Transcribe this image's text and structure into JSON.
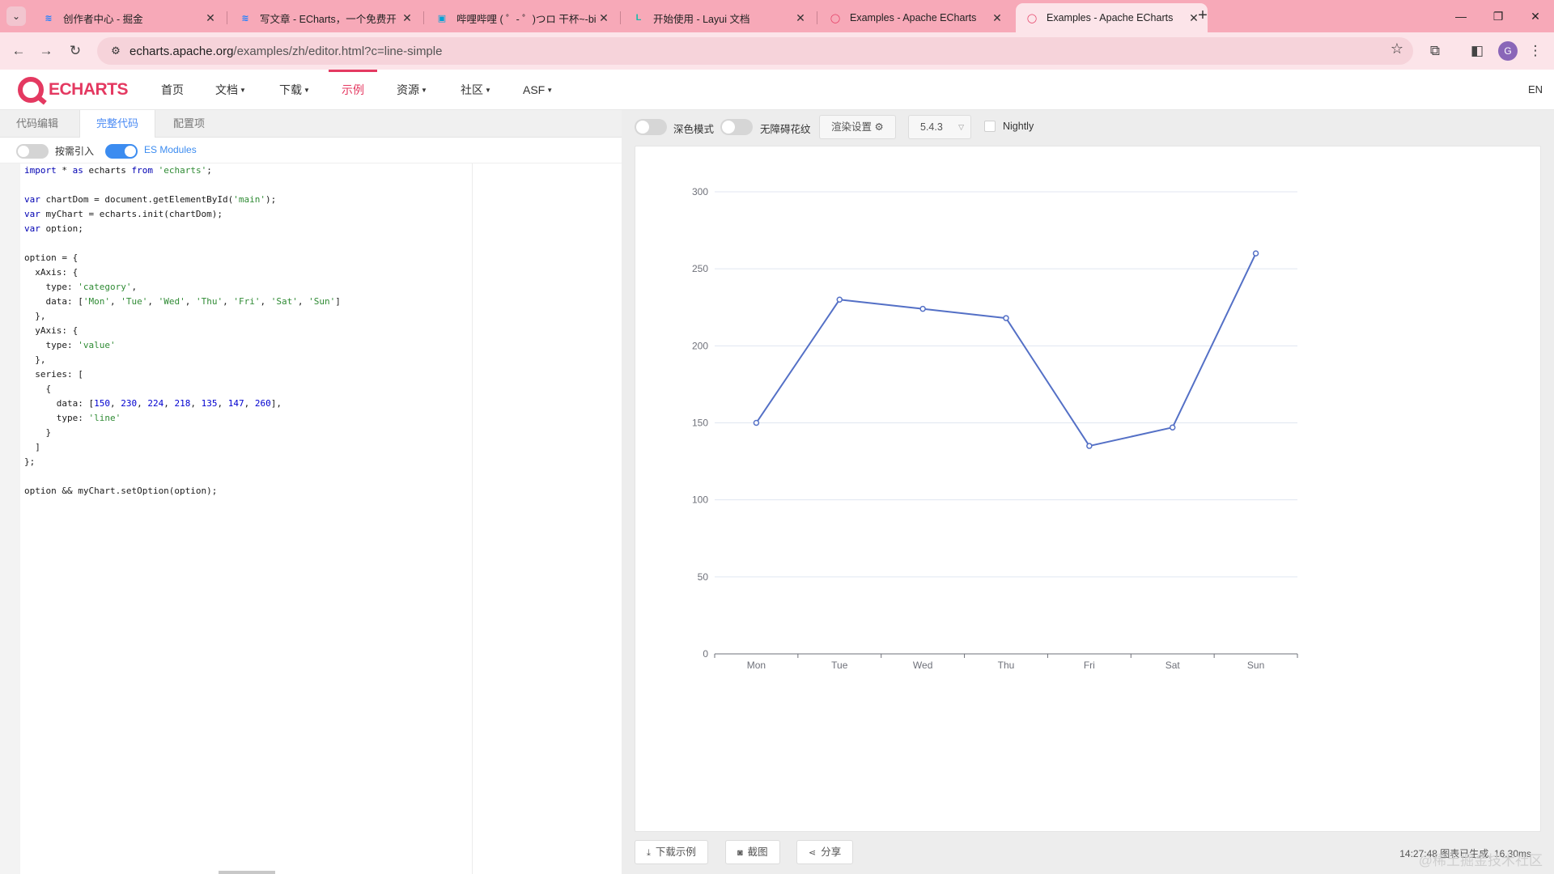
{
  "browser": {
    "tabs": [
      {
        "title": "创作者中心 - 掘金",
        "favicon": "juejin-logo-icon",
        "active": false
      },
      {
        "title": "写文章 - ECharts，一个免费开",
        "favicon": "juejin-logo-icon",
        "active": false
      },
      {
        "title": "哔哩哔哩 ( ゜- ゜)つロ 干杯~-bi",
        "favicon": "bilibili-logo-icon",
        "active": false
      },
      {
        "title": "开始使用 - Layui 文档",
        "favicon": "layui-logo-icon",
        "active": false
      },
      {
        "title": "Examples - Apache ECharts",
        "favicon": "echarts-logo-icon",
        "active": false
      },
      {
        "title": "Examples - Apache ECharts",
        "favicon": "echarts-logo-icon",
        "active": true
      }
    ],
    "url_host": "echarts.apache.org",
    "url_path": "/examples/zh/editor.html?c=line-simple",
    "profile_initial": "G"
  },
  "site": {
    "logo_text": "ECHARTS",
    "nav": [
      {
        "label": "首页",
        "caret": false,
        "active": false
      },
      {
        "label": "文档",
        "caret": true,
        "active": false
      },
      {
        "label": "下载",
        "caret": true,
        "active": false
      },
      {
        "label": "示例",
        "caret": false,
        "active": true
      },
      {
        "label": "资源",
        "caret": true,
        "active": false
      },
      {
        "label": "社区",
        "caret": true,
        "active": false
      },
      {
        "label": "ASF",
        "caret": true,
        "active": false
      }
    ],
    "lang": "EN"
  },
  "editor": {
    "tabs": [
      "代码编辑",
      "完整代码",
      "配置项"
    ],
    "active_tab": 1,
    "options": {
      "on_demand_label": "按需引入",
      "on_demand_enabled": false,
      "esm_label": "ES Modules",
      "esm_enabled": true
    },
    "code_lines": [
      "import * as echarts from 'echarts';",
      "",
      "var chartDom = document.getElementById('main');",
      "var myChart = echarts.init(chartDom);",
      "var option;",
      "",
      "option = {",
      "  xAxis: {",
      "    type: 'category',",
      "    data: ['Mon', 'Tue', 'Wed', 'Thu', 'Fri', 'Sat', 'Sun']",
      "  },",
      "  yAxis: {",
      "    type: 'value'",
      "  },",
      "  series: [",
      "    {",
      "      data: [150, 230, 224, 218, 135, 147, 260],",
      "      type: 'line'",
      "    }",
      "  ]",
      "};",
      "",
      "option && myChart.setOption(option);"
    ]
  },
  "preview": {
    "dark_mode_label": "深色模式",
    "decal_label": "无障碍花纹",
    "render_settings_label": "渲染设置",
    "version": "5.4.3",
    "nightly_label": "Nightly",
    "download_label": "下载示例",
    "screenshot_label": "截图",
    "share_label": "分享",
    "status": "14:27:48  图表已生成, 16.30ms",
    "watermark": "@稀土掘金技术社区"
  },
  "chart_data": {
    "type": "line",
    "categories": [
      "Mon",
      "Tue",
      "Wed",
      "Thu",
      "Fri",
      "Sat",
      "Sun"
    ],
    "series": [
      {
        "values": [
          150,
          230,
          224,
          218,
          135,
          147,
          260
        ]
      }
    ],
    "y_ticks": [
      "0",
      "50",
      "100",
      "150",
      "200",
      "250",
      "300"
    ],
    "ylim": [
      0,
      300
    ],
    "grid": true,
    "color": "#5470c6"
  },
  "colors": {
    "brand": "#e43961",
    "accent_blue": "#3c8cf0",
    "tabstrip_bg": "#f7a9b8",
    "toolbar_bg": "#fce4e9"
  }
}
